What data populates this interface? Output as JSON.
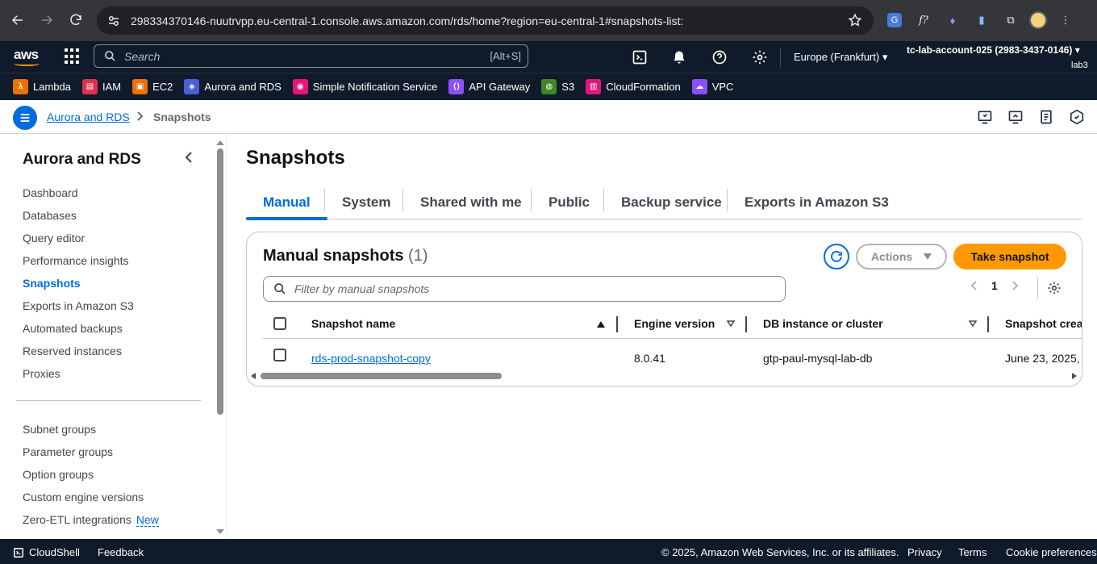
{
  "browser": {
    "url": "298334370146-nuutrvpp.eu-central-1.console.aws.amazon.com/rds/home?region=eu-central-1#snapshots-list:"
  },
  "aws_header": {
    "logo": "aws",
    "search_placeholder": "Search",
    "search_shortcut": "[Alt+S]",
    "region": "Europe (Frankfurt)",
    "account": "tc-lab-account-025 (2983-3437-0146)",
    "role": "lab3"
  },
  "favorites": [
    {
      "label": "Lambda",
      "color": "#ed7100",
      "icon": "lambda-icon",
      "glyph": "λ"
    },
    {
      "label": "IAM",
      "color": "#dd344c",
      "icon": "iam-icon",
      "glyph": "▤"
    },
    {
      "label": "EC2",
      "color": "#ed7100",
      "icon": "ec2-icon",
      "glyph": "▣"
    },
    {
      "label": "Aurora and RDS",
      "color": "#4d5fd8",
      "icon": "rds-icon",
      "glyph": "◈"
    },
    {
      "label": "Simple Notification Service",
      "color": "#e7157b",
      "icon": "sns-icon",
      "glyph": "◉"
    },
    {
      "label": "API Gateway",
      "color": "#8c4fff",
      "icon": "api-gateway-icon",
      "glyph": "⟨⟩"
    },
    {
      "label": "S3",
      "color": "#3f8624",
      "icon": "s3-icon",
      "glyph": "◍"
    },
    {
      "label": "CloudFormation",
      "color": "#e7157b",
      "icon": "cloudformation-icon",
      "glyph": "▥"
    },
    {
      "label": "VPC",
      "color": "#8c4fff",
      "icon": "vpc-icon",
      "glyph": "☁"
    }
  ],
  "breadcrumb": {
    "parent": "Aurora and RDS",
    "current": "Snapshots"
  },
  "sidebar": {
    "title": "Aurora and RDS",
    "items": [
      {
        "label": "Dashboard"
      },
      {
        "label": "Databases"
      },
      {
        "label": "Query editor"
      },
      {
        "label": "Performance insights"
      },
      {
        "label": "Snapshots",
        "active": true
      },
      {
        "label": "Exports in Amazon S3"
      },
      {
        "label": "Automated backups"
      },
      {
        "label": "Reserved instances"
      },
      {
        "label": "Proxies"
      }
    ],
    "items2": [
      {
        "label": "Subnet groups"
      },
      {
        "label": "Parameter groups"
      },
      {
        "label": "Option groups"
      },
      {
        "label": "Custom engine versions"
      },
      {
        "label": "Zero-ETL integrations",
        "badge": "New"
      }
    ]
  },
  "main": {
    "title": "Snapshots",
    "tabs": [
      {
        "label": "Manual",
        "active": true
      },
      {
        "label": "System"
      },
      {
        "label": "Shared with me"
      },
      {
        "label": "Public"
      },
      {
        "label": "Backup service"
      },
      {
        "label": "Exports in Amazon S3"
      }
    ],
    "panel": {
      "title": "Manual snapshots",
      "count": "(1)",
      "actions_label": "Actions",
      "take_label": "Take snapshot",
      "filter_placeholder": "Filter by manual snapshots",
      "page": "1",
      "columns": [
        "Snapshot name",
        "Engine version",
        "DB instance or cluster",
        "Snapshot creat"
      ],
      "rows": [
        {
          "name": "rds-prod-snapshot-copy",
          "engine": "8.0.41",
          "instance": "gtp-paul-mysql-lab-db",
          "created": "June 23, 2025,"
        }
      ]
    }
  },
  "footer": {
    "cloudshell": "CloudShell",
    "feedback": "Feedback",
    "copyright": "© 2025, Amazon Web Services, Inc. or its affiliates.",
    "privacy": "Privacy",
    "terms": "Terms",
    "cookies": "Cookie preferences"
  }
}
